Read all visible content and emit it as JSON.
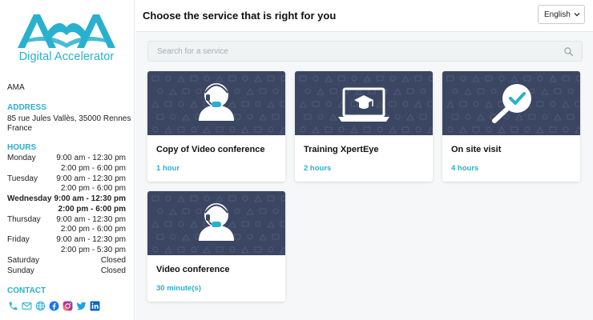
{
  "colors": {
    "accent": "#2ab0cf",
    "banner": "#3b4662"
  },
  "brand": {
    "logo_mark": "AMA",
    "logo_text": "Digital Accelerator"
  },
  "business": {
    "name": "AMA",
    "address_title": "ADDRESS",
    "address": "85 rue Jules Vallès, 35000 Rennes France",
    "hours_title": "HOURS",
    "hours": [
      {
        "day": "Monday",
        "times": [
          "9:00 am - 12:30 pm",
          "2:00 pm - 6:00 pm"
        ]
      },
      {
        "day": "Tuesday",
        "times": [
          "9:00 am - 12:30 pm",
          "2:00 pm - 6:00 pm"
        ]
      },
      {
        "day": "Wednesday",
        "times": [
          "9:00 am - 12:30 pm",
          "2:00 pm - 6:00 pm"
        ],
        "today": true
      },
      {
        "day": "Thursday",
        "times": [
          "9:00 am - 12:30 pm",
          "2:00 pm - 6:00 pm"
        ]
      },
      {
        "day": "Friday",
        "times": [
          "9:00 am - 12:30 pm",
          "2:00 pm - 5:30 pm"
        ]
      },
      {
        "day": "Saturday",
        "times": [
          "Closed"
        ]
      },
      {
        "day": "Sunday",
        "times": [
          "Closed"
        ]
      }
    ],
    "contact_title": "CONTACT",
    "contact_icons": [
      "phone-icon",
      "email-icon",
      "globe-icon",
      "facebook-icon",
      "instagram-icon",
      "twitter-icon",
      "linkedin-icon"
    ]
  },
  "header": {
    "title": "Choose the service that is right for you",
    "language": "English"
  },
  "search": {
    "placeholder": "Search for a service"
  },
  "services": [
    {
      "title": "Copy of Video conference",
      "duration": "1 hour",
      "icon": "headset-person-icon"
    },
    {
      "title": "Training XpertEye",
      "duration": "2 hours",
      "icon": "laptop-graduation-icon"
    },
    {
      "title": "On site visit",
      "duration": "4 hours",
      "icon": "magnifier-check-icon"
    },
    {
      "title": "Video conference",
      "duration": "30 minute(s)",
      "icon": "headset-person-icon"
    }
  ]
}
